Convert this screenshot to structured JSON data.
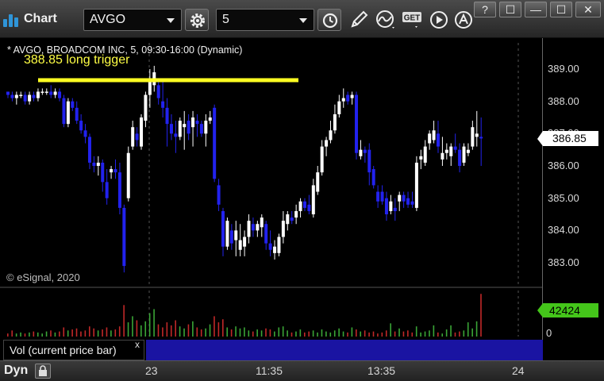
{
  "window": {
    "title": "Chart"
  },
  "toolbar": {
    "symbol": "AVGO",
    "interval": "5",
    "get_label": "GET",
    "window_controls": [
      "?",
      "☐",
      "—",
      "☐",
      "✕"
    ]
  },
  "chart": {
    "header": "* AVGO, BROADCOM INC, 5, 09:30-16:00 (Dynamic)",
    "annotation": "388.85 long trigger",
    "copyright": "© eSignal, 2020",
    "price_ticks": [
      "389.00",
      "388.00",
      "387.00",
      "386.00",
      "385.00",
      "384.00",
      "383.00"
    ],
    "last_price": "386.85",
    "last_volume": "42424",
    "volume_zero": "0",
    "volume_legend": "Vol (current price bar)",
    "volume_close": "x",
    "time_labels": [
      "23",
      "11:35",
      "13:35",
      "24"
    ],
    "status_label": "Dyn",
    "colors": {
      "up": "#ffffff",
      "down": "#2222ee",
      "trigger_line": "#ffff22",
      "volume_panel": "#1a14a2"
    }
  },
  "chart_data": {
    "type": "candlestick",
    "symbol": "AVGO",
    "interval_minutes": 5,
    "y_axis_range": [
      382.6,
      389.4
    ],
    "x_tick_labels": [
      "23",
      "11:35",
      "13:35",
      "24"
    ],
    "horizontal_line": {
      "label": "388.85 long trigger"
    },
    "candles": [
      [
        388.3,
        388.3,
        388.1,
        388.2
      ],
      [
        388.2,
        388.3,
        388.0,
        388.1
      ],
      [
        388.1,
        388.3,
        387.9,
        388.2
      ],
      [
        388.2,
        388.3,
        388.1,
        388.2
      ],
      [
        388.2,
        388.3,
        387.9,
        388.0
      ],
      [
        388.0,
        388.3,
        387.9,
        388.2
      ],
      [
        388.2,
        388.3,
        388.0,
        388.1
      ],
      [
        388.1,
        388.4,
        388.0,
        388.3
      ],
      [
        388.3,
        388.4,
        388.2,
        388.3
      ],
      [
        388.3,
        388.4,
        388.2,
        388.3
      ],
      [
        388.3,
        388.5,
        388.1,
        388.2
      ],
      [
        388.2,
        388.4,
        388.1,
        388.3
      ],
      [
        388.3,
        388.4,
        388.0,
        388.1
      ],
      [
        388.1,
        388.2,
        387.2,
        387.3
      ],
      [
        387.3,
        388.1,
        387.2,
        388.0
      ],
      [
        388.0,
        388.1,
        387.7,
        387.8
      ],
      [
        387.8,
        388.0,
        387.3,
        387.4
      ],
      [
        387.4,
        387.6,
        387.0,
        387.1
      ],
      [
        387.1,
        387.3,
        386.7,
        386.9
      ],
      [
        386.9,
        387.0,
        385.9,
        386.1
      ],
      [
        386.1,
        386.3,
        385.8,
        386.0
      ],
      [
        386.0,
        386.3,
        385.7,
        386.1
      ],
      [
        386.1,
        386.2,
        385.2,
        385.5
      ],
      [
        385.5,
        385.9,
        384.8,
        385.0
      ],
      [
        385.8,
        386.0,
        385.6,
        385.9
      ],
      [
        385.9,
        386.2,
        385.6,
        385.8
      ],
      [
        385.8,
        386.1,
        384.5,
        384.7
      ],
      [
        384.7,
        384.8,
        382.7,
        382.9
      ],
      [
        385.0,
        386.6,
        384.9,
        386.4
      ],
      [
        386.6,
        387.4,
        386.5,
        387.2
      ],
      [
        387.0,
        387.2,
        386.6,
        386.8
      ],
      [
        386.6,
        387.6,
        386.5,
        387.5
      ],
      [
        387.4,
        388.3,
        387.2,
        388.2
      ],
      [
        388.2,
        389.0,
        387.8,
        388.6
      ],
      [
        388.5,
        389.1,
        388.3,
        388.9
      ],
      [
        388.5,
        388.7,
        387.9,
        388.1
      ],
      [
        388.0,
        388.6,
        387.5,
        387.8
      ],
      [
        387.8,
        388.1,
        386.6,
        387.3
      ],
      [
        387.3,
        387.6,
        386.8,
        387.0
      ],
      [
        387.0,
        387.4,
        386.4,
        386.9
      ],
      [
        386.9,
        387.5,
        386.8,
        387.4
      ],
      [
        387.2,
        387.7,
        386.5,
        387.3
      ],
      [
        387.4,
        387.6,
        386.8,
        387.0
      ],
      [
        387.2,
        387.7,
        386.6,
        387.5
      ],
      [
        387.4,
        387.6,
        386.9,
        387.3
      ],
      [
        387.3,
        387.4,
        386.9,
        387.0
      ],
      [
        387.0,
        387.6,
        386.6,
        387.4
      ],
      [
        387.4,
        387.7,
        387.3,
        387.5
      ],
      [
        387.8,
        387.9,
        385.5,
        385.6
      ],
      [
        385.4,
        385.6,
        384.6,
        384.8
      ],
      [
        384.6,
        384.7,
        383.2,
        383.5
      ],
      [
        383.5,
        384.4,
        383.4,
        384.3
      ],
      [
        384.0,
        384.2,
        383.4,
        383.6
      ],
      [
        383.7,
        384.3,
        383.2,
        384.0
      ],
      [
        383.4,
        384.2,
        383.2,
        383.7
      ],
      [
        383.5,
        384.0,
        383.2,
        383.8
      ],
      [
        383.8,
        384.5,
        383.6,
        384.3
      ],
      [
        384.2,
        384.4,
        383.8,
        384.0
      ],
      [
        384.0,
        384.3,
        383.8,
        384.2
      ],
      [
        384.1,
        384.5,
        383.8,
        384.4
      ],
      [
        384.2,
        384.3,
        383.4,
        383.6
      ],
      [
        383.6,
        384.0,
        383.2,
        383.4
      ],
      [
        383.3,
        383.7,
        383.1,
        383.5
      ],
      [
        383.3,
        383.9,
        383.2,
        383.8
      ],
      [
        383.8,
        384.6,
        383.6,
        384.3
      ],
      [
        384.2,
        384.6,
        384.0,
        384.5
      ],
      [
        384.4,
        384.6,
        384.2,
        384.3
      ],
      [
        384.4,
        384.8,
        384.2,
        384.6
      ],
      [
        384.6,
        385.0,
        384.4,
        384.9
      ],
      [
        384.9,
        385.0,
        384.6,
        384.7
      ],
      [
        384.8,
        385.1,
        384.5,
        384.6
      ],
      [
        384.5,
        385.6,
        384.4,
        385.4
      ],
      [
        385.2,
        386.0,
        385.1,
        385.8
      ],
      [
        385.8,
        386.8,
        385.7,
        386.6
      ],
      [
        386.6,
        386.9,
        386.3,
        386.8
      ],
      [
        386.8,
        387.4,
        386.7,
        387.1
      ],
      [
        387.1,
        387.9,
        387.0,
        387.6
      ],
      [
        387.6,
        388.2,
        387.5,
        388.0
      ],
      [
        388.0,
        388.4,
        387.8,
        388.1
      ],
      [
        388.2,
        388.3,
        387.9,
        388.0
      ],
      [
        388.1,
        388.3,
        387.9,
        388.2
      ],
      [
        388.2,
        388.3,
        386.2,
        386.4
      ],
      [
        386.3,
        386.8,
        386.2,
        386.5
      ],
      [
        386.5,
        386.6,
        386.1,
        386.4
      ],
      [
        386.5,
        386.7,
        385.4,
        385.8
      ],
      [
        385.9,
        386.0,
        385.3,
        385.4
      ],
      [
        385.2,
        385.4,
        384.7,
        384.9
      ],
      [
        385.2,
        385.4,
        384.8,
        384.9
      ],
      [
        385.0,
        385.2,
        384.3,
        384.5
      ],
      [
        384.6,
        385.1,
        384.5,
        384.9
      ],
      [
        384.7,
        385.0,
        384.3,
        384.6
      ],
      [
        384.9,
        385.2,
        384.6,
        385.1
      ],
      [
        385.1,
        385.2,
        384.7,
        384.9
      ],
      [
        385.0,
        385.2,
        384.7,
        384.8
      ],
      [
        384.9,
        385.2,
        384.7,
        384.8
      ],
      [
        384.7,
        386.3,
        384.6,
        386.1
      ],
      [
        386.2,
        386.5,
        385.9,
        386.3
      ],
      [
        386.1,
        386.8,
        386.0,
        386.6
      ],
      [
        386.7,
        387.1,
        386.5,
        387.0
      ],
      [
        386.8,
        387.4,
        386.7,
        387.1
      ],
      [
        387.0,
        387.4,
        386.4,
        386.6
      ],
      [
        386.2,
        386.9,
        386.0,
        386.4
      ],
      [
        386.4,
        386.7,
        386.2,
        386.5
      ],
      [
        386.3,
        386.7,
        386.0,
        386.6
      ],
      [
        386.6,
        387.0,
        386.4,
        386.5
      ],
      [
        386.5,
        386.7,
        385.8,
        386.0
      ],
      [
        386.1,
        386.7,
        386.0,
        386.6
      ],
      [
        386.4,
        386.7,
        386.3,
        386.5
      ],
      [
        386.6,
        387.4,
        386.5,
        387.2
      ],
      [
        386.9,
        387.7,
        386.6,
        387.0
      ],
      [
        386.9,
        387.5,
        386.0,
        386.85
      ]
    ],
    "volume": [
      3,
      6,
      3,
      4,
      3,
      4,
      5,
      4,
      3,
      5,
      6,
      4,
      5,
      9,
      6,
      7,
      8,
      5,
      6,
      10,
      8,
      6,
      7,
      9,
      6,
      7,
      10,
      31,
      14,
      20,
      16,
      11,
      15,
      23,
      27,
      12,
      9,
      14,
      11,
      16,
      10,
      8,
      12,
      15,
      9,
      7,
      8,
      12,
      20,
      14,
      17,
      9,
      7,
      10,
      8,
      9,
      6,
      5,
      7,
      6,
      8,
      7,
      5,
      9,
      10,
      6,
      4,
      5,
      7,
      4,
      5,
      6,
      4,
      7,
      5,
      4,
      6,
      8,
      5,
      4,
      9,
      7,
      5,
      6,
      4,
      5,
      3,
      4,
      6,
      13,
      5,
      8,
      5,
      6,
      4,
      10,
      4,
      5,
      6,
      11,
      4,
      3,
      7,
      11,
      4,
      5,
      6,
      14,
      8,
      15,
      42
    ]
  }
}
